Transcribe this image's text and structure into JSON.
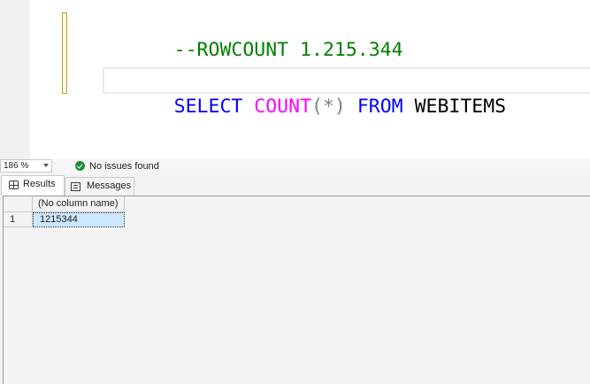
{
  "editor": {
    "lines": [
      {
        "tokens": [
          {
            "text": "--ROWCOUNT 1.215.344",
            "kind": "comment"
          }
        ]
      },
      {
        "tokens": [
          {
            "text": "SELECT",
            "kind": "keyword"
          },
          {
            "text": " ",
            "kind": "space"
          },
          {
            "text": "COUNT",
            "kind": "func"
          },
          {
            "text": "(*)",
            "kind": "punct"
          },
          {
            "text": " ",
            "kind": "space"
          },
          {
            "text": "FROM",
            "kind": "keyword"
          },
          {
            "text": " ",
            "kind": "space"
          },
          {
            "text": "WEBITEMS",
            "kind": "ident"
          }
        ]
      }
    ],
    "colors": {
      "comment": "#008000",
      "keyword": "#0000ff",
      "func": "#ff00ff",
      "punct": "#808080",
      "ident": "#000000"
    }
  },
  "status": {
    "zoom": "186 %",
    "issues_icon": "check-circle-icon",
    "issues_text": "No issues found"
  },
  "results": {
    "tabs": [
      {
        "label": "Results",
        "icon": "grid-icon",
        "active": true
      },
      {
        "label": "Messages",
        "icon": "messages-icon",
        "active": false
      }
    ],
    "grid": {
      "columns": [
        "(No column name)"
      ],
      "rows": [
        {
          "row_number": "1",
          "cells": [
            "1215344"
          ]
        }
      ]
    }
  }
}
